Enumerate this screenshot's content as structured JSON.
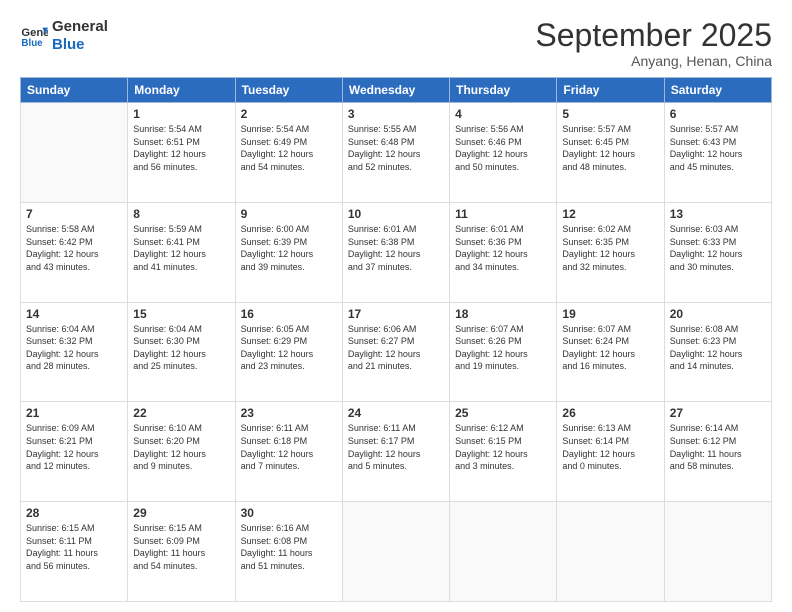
{
  "logo": {
    "text1": "General",
    "text2": "Blue"
  },
  "header": {
    "month": "September 2025",
    "location": "Anyang, Henan, China"
  },
  "days_of_week": [
    "Sunday",
    "Monday",
    "Tuesday",
    "Wednesday",
    "Thursday",
    "Friday",
    "Saturday"
  ],
  "weeks": [
    [
      {
        "day": "",
        "info": ""
      },
      {
        "day": "1",
        "info": "Sunrise: 5:54 AM\nSunset: 6:51 PM\nDaylight: 12 hours\nand 56 minutes."
      },
      {
        "day": "2",
        "info": "Sunrise: 5:54 AM\nSunset: 6:49 PM\nDaylight: 12 hours\nand 54 minutes."
      },
      {
        "day": "3",
        "info": "Sunrise: 5:55 AM\nSunset: 6:48 PM\nDaylight: 12 hours\nand 52 minutes."
      },
      {
        "day": "4",
        "info": "Sunrise: 5:56 AM\nSunset: 6:46 PM\nDaylight: 12 hours\nand 50 minutes."
      },
      {
        "day": "5",
        "info": "Sunrise: 5:57 AM\nSunset: 6:45 PM\nDaylight: 12 hours\nand 48 minutes."
      },
      {
        "day": "6",
        "info": "Sunrise: 5:57 AM\nSunset: 6:43 PM\nDaylight: 12 hours\nand 45 minutes."
      }
    ],
    [
      {
        "day": "7",
        "info": "Sunrise: 5:58 AM\nSunset: 6:42 PM\nDaylight: 12 hours\nand 43 minutes."
      },
      {
        "day": "8",
        "info": "Sunrise: 5:59 AM\nSunset: 6:41 PM\nDaylight: 12 hours\nand 41 minutes."
      },
      {
        "day": "9",
        "info": "Sunrise: 6:00 AM\nSunset: 6:39 PM\nDaylight: 12 hours\nand 39 minutes."
      },
      {
        "day": "10",
        "info": "Sunrise: 6:01 AM\nSunset: 6:38 PM\nDaylight: 12 hours\nand 37 minutes."
      },
      {
        "day": "11",
        "info": "Sunrise: 6:01 AM\nSunset: 6:36 PM\nDaylight: 12 hours\nand 34 minutes."
      },
      {
        "day": "12",
        "info": "Sunrise: 6:02 AM\nSunset: 6:35 PM\nDaylight: 12 hours\nand 32 minutes."
      },
      {
        "day": "13",
        "info": "Sunrise: 6:03 AM\nSunset: 6:33 PM\nDaylight: 12 hours\nand 30 minutes."
      }
    ],
    [
      {
        "day": "14",
        "info": "Sunrise: 6:04 AM\nSunset: 6:32 PM\nDaylight: 12 hours\nand 28 minutes."
      },
      {
        "day": "15",
        "info": "Sunrise: 6:04 AM\nSunset: 6:30 PM\nDaylight: 12 hours\nand 25 minutes."
      },
      {
        "day": "16",
        "info": "Sunrise: 6:05 AM\nSunset: 6:29 PM\nDaylight: 12 hours\nand 23 minutes."
      },
      {
        "day": "17",
        "info": "Sunrise: 6:06 AM\nSunset: 6:27 PM\nDaylight: 12 hours\nand 21 minutes."
      },
      {
        "day": "18",
        "info": "Sunrise: 6:07 AM\nSunset: 6:26 PM\nDaylight: 12 hours\nand 19 minutes."
      },
      {
        "day": "19",
        "info": "Sunrise: 6:07 AM\nSunset: 6:24 PM\nDaylight: 12 hours\nand 16 minutes."
      },
      {
        "day": "20",
        "info": "Sunrise: 6:08 AM\nSunset: 6:23 PM\nDaylight: 12 hours\nand 14 minutes."
      }
    ],
    [
      {
        "day": "21",
        "info": "Sunrise: 6:09 AM\nSunset: 6:21 PM\nDaylight: 12 hours\nand 12 minutes."
      },
      {
        "day": "22",
        "info": "Sunrise: 6:10 AM\nSunset: 6:20 PM\nDaylight: 12 hours\nand 9 minutes."
      },
      {
        "day": "23",
        "info": "Sunrise: 6:11 AM\nSunset: 6:18 PM\nDaylight: 12 hours\nand 7 minutes."
      },
      {
        "day": "24",
        "info": "Sunrise: 6:11 AM\nSunset: 6:17 PM\nDaylight: 12 hours\nand 5 minutes."
      },
      {
        "day": "25",
        "info": "Sunrise: 6:12 AM\nSunset: 6:15 PM\nDaylight: 12 hours\nand 3 minutes."
      },
      {
        "day": "26",
        "info": "Sunrise: 6:13 AM\nSunset: 6:14 PM\nDaylight: 12 hours\nand 0 minutes."
      },
      {
        "day": "27",
        "info": "Sunrise: 6:14 AM\nSunset: 6:12 PM\nDaylight: 11 hours\nand 58 minutes."
      }
    ],
    [
      {
        "day": "28",
        "info": "Sunrise: 6:15 AM\nSunset: 6:11 PM\nDaylight: 11 hours\nand 56 minutes."
      },
      {
        "day": "29",
        "info": "Sunrise: 6:15 AM\nSunset: 6:09 PM\nDaylight: 11 hours\nand 54 minutes."
      },
      {
        "day": "30",
        "info": "Sunrise: 6:16 AM\nSunset: 6:08 PM\nDaylight: 11 hours\nand 51 minutes."
      },
      {
        "day": "",
        "info": ""
      },
      {
        "day": "",
        "info": ""
      },
      {
        "day": "",
        "info": ""
      },
      {
        "day": "",
        "info": ""
      }
    ]
  ]
}
